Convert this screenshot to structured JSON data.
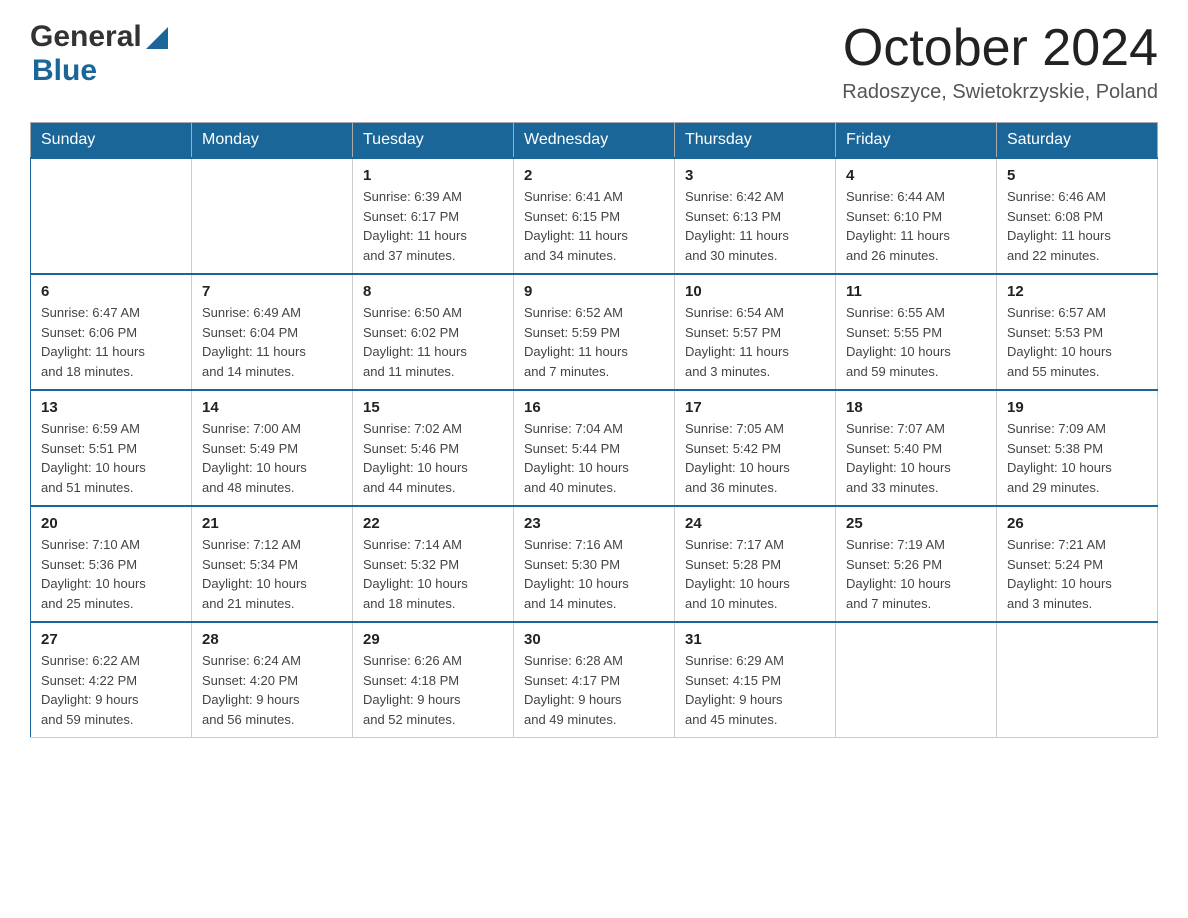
{
  "header": {
    "logo": {
      "general_text": "General",
      "blue_text": "Blue"
    },
    "title": "October 2024",
    "location": "Radoszyce, Swietokrzyskie, Poland"
  },
  "calendar": {
    "days_of_week": [
      "Sunday",
      "Monday",
      "Tuesday",
      "Wednesday",
      "Thursday",
      "Friday",
      "Saturday"
    ],
    "weeks": [
      [
        {
          "day": "",
          "info": ""
        },
        {
          "day": "",
          "info": ""
        },
        {
          "day": "1",
          "info": "Sunrise: 6:39 AM\nSunset: 6:17 PM\nDaylight: 11 hours\nand 37 minutes."
        },
        {
          "day": "2",
          "info": "Sunrise: 6:41 AM\nSunset: 6:15 PM\nDaylight: 11 hours\nand 34 minutes."
        },
        {
          "day": "3",
          "info": "Sunrise: 6:42 AM\nSunset: 6:13 PM\nDaylight: 11 hours\nand 30 minutes."
        },
        {
          "day": "4",
          "info": "Sunrise: 6:44 AM\nSunset: 6:10 PM\nDaylight: 11 hours\nand 26 minutes."
        },
        {
          "day": "5",
          "info": "Sunrise: 6:46 AM\nSunset: 6:08 PM\nDaylight: 11 hours\nand 22 minutes."
        }
      ],
      [
        {
          "day": "6",
          "info": "Sunrise: 6:47 AM\nSunset: 6:06 PM\nDaylight: 11 hours\nand 18 minutes."
        },
        {
          "day": "7",
          "info": "Sunrise: 6:49 AM\nSunset: 6:04 PM\nDaylight: 11 hours\nand 14 minutes."
        },
        {
          "day": "8",
          "info": "Sunrise: 6:50 AM\nSunset: 6:02 PM\nDaylight: 11 hours\nand 11 minutes."
        },
        {
          "day": "9",
          "info": "Sunrise: 6:52 AM\nSunset: 5:59 PM\nDaylight: 11 hours\nand 7 minutes."
        },
        {
          "day": "10",
          "info": "Sunrise: 6:54 AM\nSunset: 5:57 PM\nDaylight: 11 hours\nand 3 minutes."
        },
        {
          "day": "11",
          "info": "Sunrise: 6:55 AM\nSunset: 5:55 PM\nDaylight: 10 hours\nand 59 minutes."
        },
        {
          "day": "12",
          "info": "Sunrise: 6:57 AM\nSunset: 5:53 PM\nDaylight: 10 hours\nand 55 minutes."
        }
      ],
      [
        {
          "day": "13",
          "info": "Sunrise: 6:59 AM\nSunset: 5:51 PM\nDaylight: 10 hours\nand 51 minutes."
        },
        {
          "day": "14",
          "info": "Sunrise: 7:00 AM\nSunset: 5:49 PM\nDaylight: 10 hours\nand 48 minutes."
        },
        {
          "day": "15",
          "info": "Sunrise: 7:02 AM\nSunset: 5:46 PM\nDaylight: 10 hours\nand 44 minutes."
        },
        {
          "day": "16",
          "info": "Sunrise: 7:04 AM\nSunset: 5:44 PM\nDaylight: 10 hours\nand 40 minutes."
        },
        {
          "day": "17",
          "info": "Sunrise: 7:05 AM\nSunset: 5:42 PM\nDaylight: 10 hours\nand 36 minutes."
        },
        {
          "day": "18",
          "info": "Sunrise: 7:07 AM\nSunset: 5:40 PM\nDaylight: 10 hours\nand 33 minutes."
        },
        {
          "day": "19",
          "info": "Sunrise: 7:09 AM\nSunset: 5:38 PM\nDaylight: 10 hours\nand 29 minutes."
        }
      ],
      [
        {
          "day": "20",
          "info": "Sunrise: 7:10 AM\nSunset: 5:36 PM\nDaylight: 10 hours\nand 25 minutes."
        },
        {
          "day": "21",
          "info": "Sunrise: 7:12 AM\nSunset: 5:34 PM\nDaylight: 10 hours\nand 21 minutes."
        },
        {
          "day": "22",
          "info": "Sunrise: 7:14 AM\nSunset: 5:32 PM\nDaylight: 10 hours\nand 18 minutes."
        },
        {
          "day": "23",
          "info": "Sunrise: 7:16 AM\nSunset: 5:30 PM\nDaylight: 10 hours\nand 14 minutes."
        },
        {
          "day": "24",
          "info": "Sunrise: 7:17 AM\nSunset: 5:28 PM\nDaylight: 10 hours\nand 10 minutes."
        },
        {
          "day": "25",
          "info": "Sunrise: 7:19 AM\nSunset: 5:26 PM\nDaylight: 10 hours\nand 7 minutes."
        },
        {
          "day": "26",
          "info": "Sunrise: 7:21 AM\nSunset: 5:24 PM\nDaylight: 10 hours\nand 3 minutes."
        }
      ],
      [
        {
          "day": "27",
          "info": "Sunrise: 6:22 AM\nSunset: 4:22 PM\nDaylight: 9 hours\nand 59 minutes."
        },
        {
          "day": "28",
          "info": "Sunrise: 6:24 AM\nSunset: 4:20 PM\nDaylight: 9 hours\nand 56 minutes."
        },
        {
          "day": "29",
          "info": "Sunrise: 6:26 AM\nSunset: 4:18 PM\nDaylight: 9 hours\nand 52 minutes."
        },
        {
          "day": "30",
          "info": "Sunrise: 6:28 AM\nSunset: 4:17 PM\nDaylight: 9 hours\nand 49 minutes."
        },
        {
          "day": "31",
          "info": "Sunrise: 6:29 AM\nSunset: 4:15 PM\nDaylight: 9 hours\nand 45 minutes."
        },
        {
          "day": "",
          "info": ""
        },
        {
          "day": "",
          "info": ""
        }
      ]
    ]
  }
}
